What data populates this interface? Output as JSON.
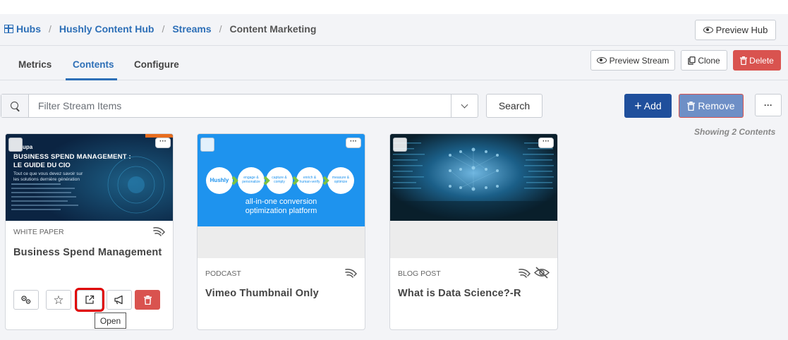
{
  "breadcrumb": {
    "items": [
      "Hubs",
      "Hushly Content Hub",
      "Streams"
    ],
    "current": "Content Marketing",
    "separator": "/"
  },
  "header_buttons": {
    "preview_hub": "Preview Hub"
  },
  "tabs": [
    {
      "label": "Metrics",
      "active": false
    },
    {
      "label": "Contents",
      "active": true
    },
    {
      "label": "Configure",
      "active": false
    }
  ],
  "stream_actions": {
    "preview_stream": "Preview Stream",
    "clone": "Clone",
    "delete": "Delete"
  },
  "filter": {
    "placeholder": "Filter Stream Items",
    "value": ""
  },
  "toolbar": {
    "search": "Search",
    "add": "Add",
    "remove": "Remove",
    "more": "···"
  },
  "showing_text": "Showing 2 Contents",
  "colors": {
    "primary": "#2d6fb7",
    "add_btn": "#1f4f9c",
    "remove_btn": "#6e8fc6",
    "danger": "#d9534f",
    "highlight": "#e00000"
  },
  "cards": [
    {
      "type": "WHITE PAPER",
      "title": "Business Spend Management",
      "thumb": {
        "logo": "upa",
        "headline_1": "BUSINESS SPEND MANAGEMENT :",
        "headline_2": "LE GUIDE DU CIO",
        "sub_1": "Tout ce que vous devez savoir sur",
        "sub_2": "les solutions dernière génération"
      },
      "actions": [
        "settings-icon",
        "star-icon",
        "open-external-icon",
        "megaphone-icon",
        "trash-icon"
      ],
      "tooltip": "Open"
    },
    {
      "type": "PODCAST",
      "title": "Vimeo Thumbnail Only",
      "thumb": {
        "brand": "Hushly",
        "steps": [
          "engage & personalize",
          "capture & comply",
          "enrich & human-verify",
          "measure & optimize"
        ],
        "tagline_1": "all-in-one conversion",
        "tagline_2": "optimization platform"
      }
    },
    {
      "type": "BLOG POST",
      "title": "What is Data Science?-R"
    }
  ]
}
